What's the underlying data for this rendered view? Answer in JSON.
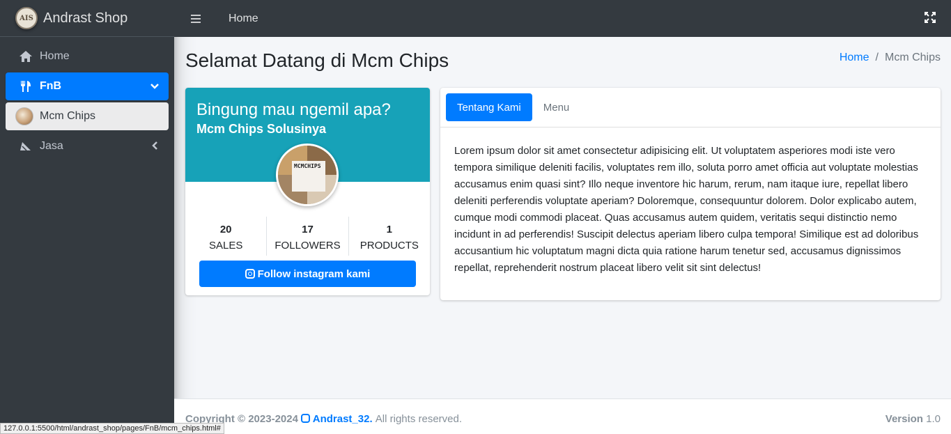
{
  "brand": {
    "name": "Andrast Shop",
    "logo_text": "AIS"
  },
  "sidebar": {
    "items": [
      {
        "label": "Home",
        "icon": "home-icon"
      },
      {
        "label": "FnB",
        "icon": "utensils-icon"
      },
      {
        "label": "Mcm Chips",
        "icon": "mcm-chips-avatar"
      },
      {
        "label": "Jasa",
        "icon": "jasa-icon"
      }
    ]
  },
  "topbar": {
    "home_label": "Home"
  },
  "page": {
    "title": "Selamat Datang di Mcm Chips",
    "breadcrumb": {
      "home": "Home",
      "separator": "/",
      "current": "Mcm Chips"
    }
  },
  "profile": {
    "title": "Bingung mau ngemil apa?",
    "subtitle": "Mcm Chips Solusinya",
    "image_label": "MCMCHIPS",
    "stats": [
      {
        "value": "20",
        "label": "SALES"
      },
      {
        "value": "17",
        "label": "FOLLOWERS"
      },
      {
        "value": "1",
        "label": "PRODUCTS"
      }
    ],
    "follow_label": "Follow instagram kami"
  },
  "tabs": {
    "items": [
      {
        "label": "Tentang Kami"
      },
      {
        "label": "Menu"
      }
    ],
    "body": "Lorem ipsum dolor sit amet consectetur adipisicing elit. Ut voluptatem asperiores modi iste vero tempora similique deleniti facilis, voluptates rem illo, soluta porro amet officia aut voluptate molestias accusamus enim quasi sint? Illo neque inventore hic harum, rerum, nam itaque iure, repellat libero deleniti perferendis voluptate aperiam? Doloremque, consequuntur dolorem. Dolor explicabo autem, cumque modi commodi placeat. Quas accusamus autem quidem, veritatis sequi distinctio nemo incidunt in ad perferendis! Suscipit delectus aperiam libero culpa tempora! Similique est ad doloribus accusantium hic voluptatum magni dicta quia ratione harum tenetur sed, accusamus dignissimos repellat, reprehenderit nostrum placeat libero velit sit sint delectus!"
  },
  "footer": {
    "copyright": "Copyright © 2023-2024",
    "brand_link": "Andrast_32.",
    "rights": "All rights reserved.",
    "version_label": "Version",
    "version_value": "1.0"
  },
  "status_bar": {
    "url": "127.0.0.1:5500/html/andrast_shop/pages/FnB/mcm_chips.html#"
  },
  "colors": {
    "primary": "#007bff",
    "info": "#17a2b8",
    "dark": "#343a40"
  }
}
